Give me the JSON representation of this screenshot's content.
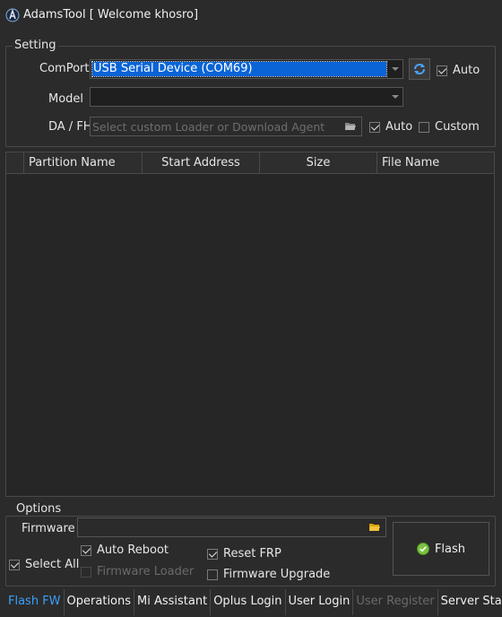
{
  "window": {
    "title": "AdamsTool [ Welcome khosro]"
  },
  "setting": {
    "group_label": "Setting",
    "comport_label": "ComPort",
    "comport_value": "USB Serial Device (COM69)",
    "comport_auto_label": "Auto",
    "comport_auto_checked": true,
    "model_label": "Model",
    "model_value": "",
    "dafh_label": "DA / FH",
    "dafh_placeholder": "Select custom Loader or Download Agent",
    "dafh_auto_label": "Auto",
    "dafh_auto_checked": true,
    "dafh_custom_label": "Custom",
    "dafh_custom_checked": false
  },
  "table": {
    "columns": [
      "Partition Name",
      "Start Address",
      "Size",
      "File Name"
    ],
    "rows": []
  },
  "options": {
    "group_label": "Options",
    "firmware_label": "Firmware",
    "firmware_value": "",
    "auto_reboot_label": "Auto Reboot",
    "auto_reboot_checked": true,
    "firmware_loader_label": "Firmware Loader",
    "firmware_loader_enabled": false,
    "reset_frp_label": "Reset FRP",
    "reset_frp_checked": true,
    "firmware_upgrade_label": "Firmware Upgrade",
    "firmware_upgrade_checked": false,
    "select_all_label": "Select All",
    "select_all_checked": true,
    "flash_label": "Flash"
  },
  "tabs": [
    {
      "label": "Flash FW",
      "state": "active"
    },
    {
      "label": "Operations",
      "state": "normal"
    },
    {
      "label": "Mi Assistant",
      "state": "normal"
    },
    {
      "label": "Oplus Login",
      "state": "normal"
    },
    {
      "label": "User Login",
      "state": "normal"
    },
    {
      "label": "User Register",
      "state": "disabled"
    },
    {
      "label": "Server Status",
      "state": "normal"
    }
  ],
  "colors": {
    "accent": "#0a64d6",
    "active_tab": "#3aa0ff",
    "background": "#2b2b2b"
  }
}
